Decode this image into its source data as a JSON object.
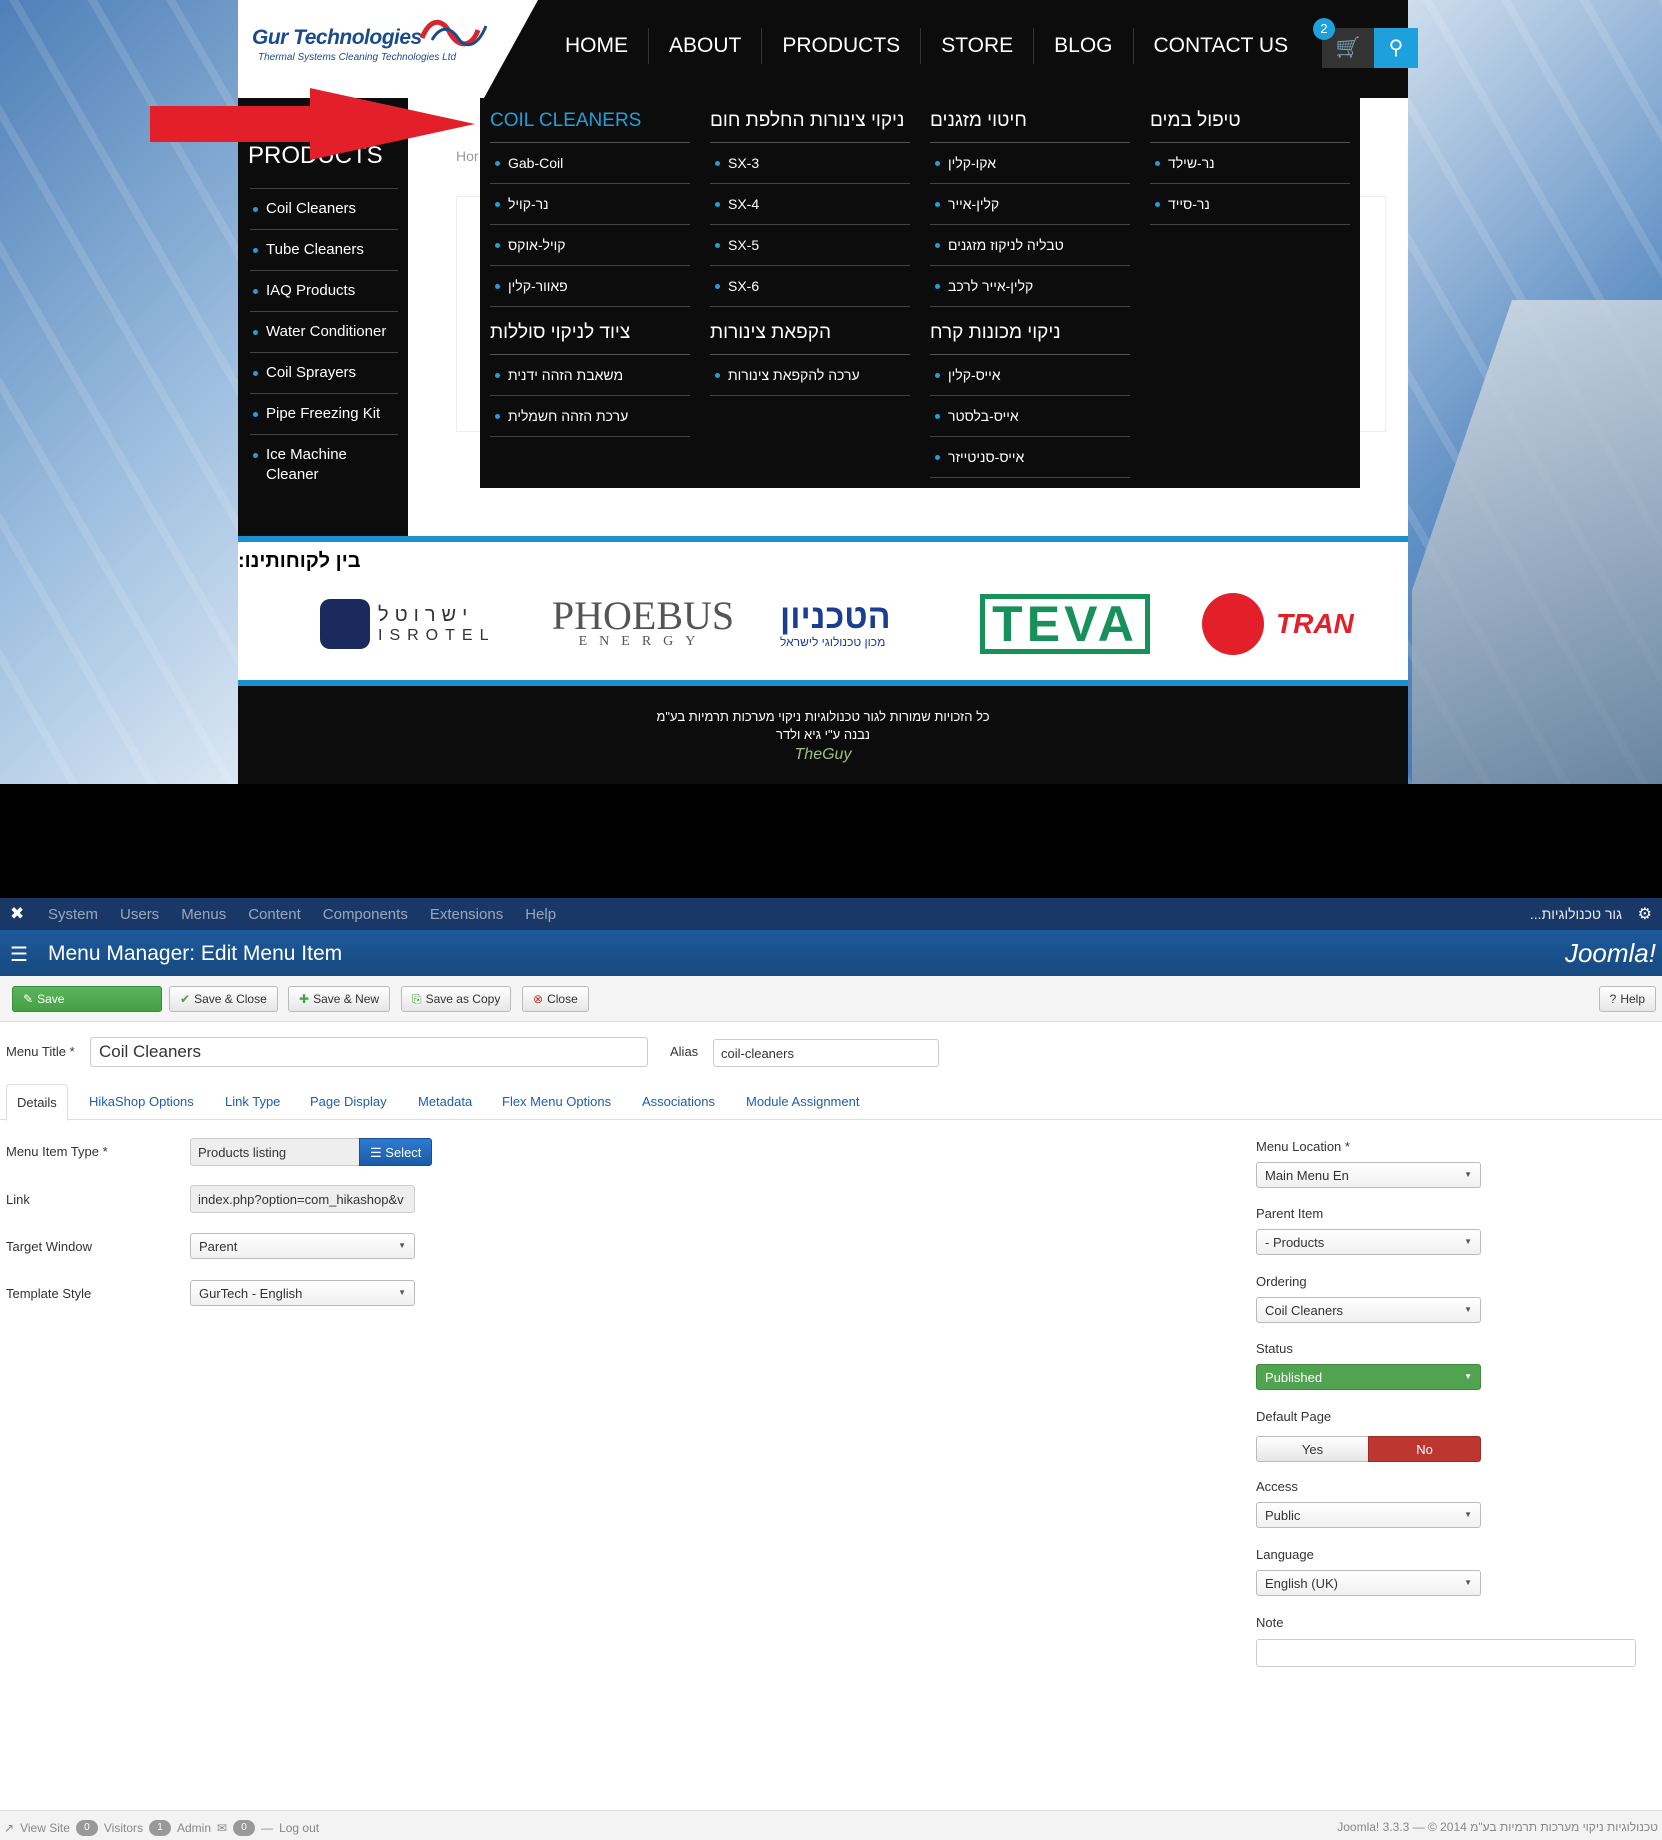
{
  "site": {
    "logo_title": "Gur Technologies",
    "logo_subtitle": "Thermal Systems Cleaning Technologies Ltd",
    "nav": [
      "HOME",
      "ABOUT",
      "PRODUCTS",
      "STORE",
      "BLOG",
      "CONTACT US"
    ],
    "cart_count": "2",
    "sidebar_title": "PRODUCTS",
    "sidebar_items": [
      "Coil Cleaners",
      "Tube Cleaners",
      "IAQ Products",
      "Water Conditioner",
      "Coil Sprayers",
      "Pipe Freezing Kit",
      "Ice Machine Cleaner"
    ],
    "breadcrumb": "Hor",
    "mega": [
      {
        "heading": "COIL CLEANERS",
        "items": [
          "Gab-Coil",
          "נר-קויל",
          "קויל-אוקס",
          "פאוור-קלין"
        ]
      },
      {
        "heading": "ניקוי צינורות החלפת חום",
        "items": [
          "SX-3",
          "SX-4",
          "SX-5",
          "SX-6"
        ]
      },
      {
        "heading": "חיטוי מזגנים",
        "items": [
          "אקו-קלין",
          "קלין-אייר",
          "טבליה לניקוז מזגנים",
          "קלין-אייר לרכב"
        ]
      },
      {
        "heading": "טיפול במים",
        "items": [
          "נר-שילד",
          "נר-סייד"
        ]
      },
      {
        "heading": "ציוד לניקוי סוללות",
        "items": [
          "משאבת הזהה ידנית",
          "ערכת הזהה חשמלית"
        ]
      },
      {
        "heading": "הקפאת צינורות",
        "items": [
          "ערכה להקפאת צינורות"
        ]
      },
      {
        "heading": "ניקוי מכונות קרח",
        "items": [
          "אייס-קלין",
          "אייס-בלסטר",
          "אייס-סניטייזר"
        ]
      }
    ],
    "clients_heading": "בין לקוחותינו:",
    "clients": {
      "isrotel_he": "ישרוטל",
      "isrotel_en": "ISROTEL",
      "phoebus": "PHOEBUS",
      "phoebus_sub": "ENERGY",
      "technion": "הטכניון",
      "technion_sub": "מכון טכנולוגי לישראל",
      "teva": "TEVA",
      "trane": "TRAN"
    },
    "footer_line1": "כל הזכויות שמורות לגור טכנולוגיות ניקוי מערכות תרמיות בע\"מ",
    "footer_line2": "נבנה ע\"י גיא ולדר",
    "footer_credit": "TheGuy"
  },
  "admin": {
    "top_menu": [
      "System",
      "Users",
      "Menus",
      "Content",
      "Components",
      "Extensions",
      "Help"
    ],
    "site_name": "גור טכנולוגיות...",
    "page_title": "Menu Manager: Edit Menu Item",
    "brand": "Joomla!",
    "toolbar": {
      "save": "Save",
      "save_close": "Save & Close",
      "save_new": "Save & New",
      "save_copy": "Save as Copy",
      "close": "Close",
      "help": "Help"
    },
    "menu_title_label": "Menu Title *",
    "menu_title_value": "Coil Cleaners",
    "alias_label": "Alias",
    "alias_value": "coil-cleaners",
    "tabs": [
      "Details",
      "HikaShop Options",
      "Link Type",
      "Page Display",
      "Metadata",
      "Flex Menu Options",
      "Associations",
      "Module Assignment"
    ],
    "left_fields": {
      "item_type_label": "Menu Item Type *",
      "item_type_value": "Products listing",
      "select_label": "Select",
      "link_label": "Link",
      "link_value": "index.php?option=com_hikashop&v",
      "target_label": "Target Window",
      "target_value": "Parent",
      "template_label": "Template Style",
      "template_value": "GurTech - English"
    },
    "right_fields": {
      "location_label": "Menu Location *",
      "location_value": "Main Menu En",
      "parent_label": "Parent Item",
      "parent_value": "- Products",
      "ordering_label": "Ordering",
      "ordering_value": "Coil Cleaners",
      "status_label": "Status",
      "status_value": "Published",
      "default_label": "Default Page",
      "default_yes": "Yes",
      "default_no": "No",
      "access_label": "Access",
      "access_value": "Public",
      "language_label": "Language",
      "language_value": "English (UK)",
      "note_label": "Note"
    },
    "status_bar": {
      "view_site": "View Site",
      "visitors_count": "0",
      "visitors": "Visitors",
      "admin_count": "1",
      "admin": "Admin",
      "msg_count": "0",
      "logout": "Log out",
      "right": "Joomla! 3.3.3 — © 2014 טכנולוגיות ניקוי מערכות תרמיות בע\"מ"
    }
  },
  "colors": {
    "accent": "#1ea0dc",
    "admin_blue": "#1a3867",
    "save_green": "#46a046",
    "no_red": "#bd362f"
  }
}
